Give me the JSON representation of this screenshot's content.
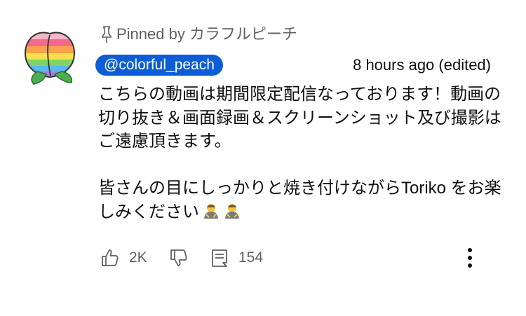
{
  "pinned": {
    "label": "Pinned by カラフルピーチ",
    "icon": "pin-icon"
  },
  "author": {
    "handle": "@colorful_peach",
    "timestamp": "8 hours ago (edited)",
    "chip_color": "#0b5ed7",
    "avatar_icon": "rainbow-peach-avatar"
  },
  "comment": {
    "paragraph_1": "こちらの動画は期間限定配信なっております！動画の切り抜き＆画面録画＆スクリーンショット及び撮影はご遠慮頂きます。",
    "paragraph_2": "皆さんの目にしっかりと焼き付けながらToriko をお楽しみください",
    "emoji": "person-bowing-emoji"
  },
  "actions": {
    "like_count": "2K",
    "reply_count": "154",
    "like_icon": "thumbs-up-icon",
    "dislike_icon": "thumbs-down-icon",
    "reply_icon": "reply-comment-icon",
    "more_icon": "more-vert-icon"
  }
}
